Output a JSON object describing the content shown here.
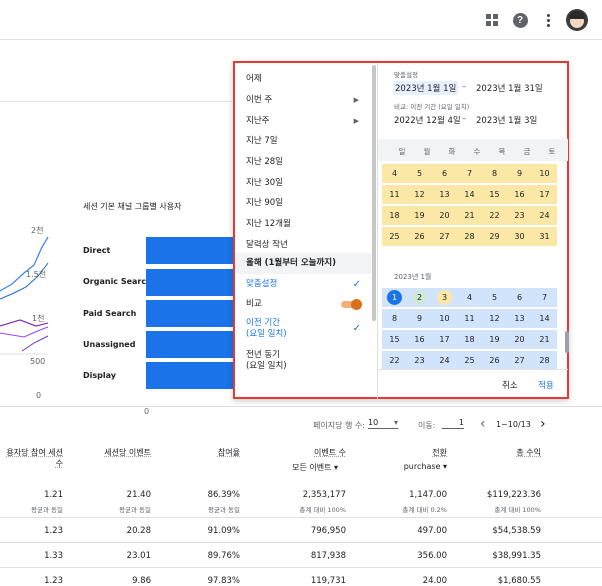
{
  "topbar": {
    "apps_icon": "apps-grid-icon",
    "help_icon": "help-icon",
    "more_icon": "more-vert-icon",
    "help_glyph": "?"
  },
  "line_chart": {
    "y_ticks": [
      "2천",
      "1.5천",
      "1천",
      "500",
      "0"
    ]
  },
  "bar_chart": {
    "title": "세션 기본 채널 그룹별 사용자",
    "categories": [
      "Direct",
      "Organic Search",
      "Paid Search",
      "Unassigned",
      "Display"
    ],
    "x_tick": "0",
    "bar_color": "#1a73e8"
  },
  "date_menu": {
    "items": [
      {
        "label": "어제"
      },
      {
        "label": "이번 주",
        "arrow": "▶"
      },
      {
        "label": "지난주",
        "arrow": "▶"
      },
      {
        "label": "지난 7일"
      },
      {
        "label": "지난 28일"
      },
      {
        "label": "지난 30일"
      },
      {
        "label": "지난 90일"
      },
      {
        "label": "지난 12개월"
      },
      {
        "label": "달력상 작년"
      },
      {
        "label": "올해 (1월부터 오늘까지)"
      },
      {
        "label": "맞춤설정",
        "check": "✓"
      },
      {
        "label": "비교"
      },
      {
        "label": "이전 기간",
        "label2": "(요일 일치)",
        "check": "✓"
      },
      {
        "label": "전년 동기",
        "label2": "(요일 일치)"
      }
    ],
    "compare_toggle": "on"
  },
  "calendar": {
    "custom_label": "맞춤설정",
    "start_date": "2023년 1월 1일",
    "dash": "–",
    "end_date": "2023년 1월 31일",
    "compare_label": "비교: 이전 기간 (요일 일치)",
    "compare_start": "2022년 12월 4일",
    "compare_end": "2023년 1월 3일",
    "weekdays": [
      "일",
      "월",
      "화",
      "수",
      "목",
      "금",
      "토"
    ],
    "dec_rows": [
      [
        "4",
        "5",
        "6",
        "7",
        "8",
        "9",
        "10"
      ],
      [
        "11",
        "12",
        "13",
        "14",
        "15",
        "16",
        "17"
      ],
      [
        "18",
        "19",
        "20",
        "21",
        "22",
        "23",
        "24"
      ],
      [
        "25",
        "26",
        "27",
        "28",
        "29",
        "30",
        "31"
      ]
    ],
    "month_label": "2023년 1월",
    "jan_rows": [
      [
        "1",
        "2",
        "3",
        "4",
        "5",
        "6",
        "7"
      ],
      [
        "8",
        "9",
        "10",
        "11",
        "12",
        "13",
        "14"
      ],
      [
        "15",
        "16",
        "17",
        "18",
        "19",
        "20",
        "21"
      ],
      [
        "22",
        "23",
        "24",
        "25",
        "26",
        "27",
        "28"
      ]
    ],
    "cancel": "취소",
    "apply": "적용",
    "yellow": "#fbe8a6",
    "blue": "#d2e3fc"
  },
  "pager": {
    "rows_label": "페이지당 행 수:",
    "rows_value": "10",
    "goto_label": "이동:",
    "goto_value": "1",
    "range": "1~10/13",
    "prev": "‹",
    "next": "›"
  },
  "table": {
    "headers": [
      {
        "label": "용자당 참여 세션수"
      },
      {
        "label": "세션당 이벤트"
      },
      {
        "label": "참여율"
      },
      {
        "label": "이벤트 수",
        "sub": "모든 이벤트 ▾"
      },
      {
        "label": "전환",
        "sub": "purchase ▾"
      },
      {
        "label": "총 수익"
      }
    ],
    "totals": [
      "1.21",
      "21.40",
      "86.39%",
      "2,353,177",
      "1,147.00",
      "$119,223.36"
    ],
    "totals_sub": [
      "평균과 동일",
      "평균과 동일",
      "평균과 동일",
      "총계 대비 100%",
      "총계 대비 0.2%",
      "총계 대비 100%"
    ],
    "rows": [
      [
        "1.23",
        "20.28",
        "91.09%",
        "796,950",
        "497.00",
        "$54,538.59"
      ],
      [
        "1.33",
        "23.01",
        "89.76%",
        "817,938",
        "356.00",
        "$38,991.35"
      ],
      [
        "1.23",
        "9.86",
        "97.83%",
        "119,731",
        "24.00",
        "$1,680.55"
      ]
    ]
  }
}
